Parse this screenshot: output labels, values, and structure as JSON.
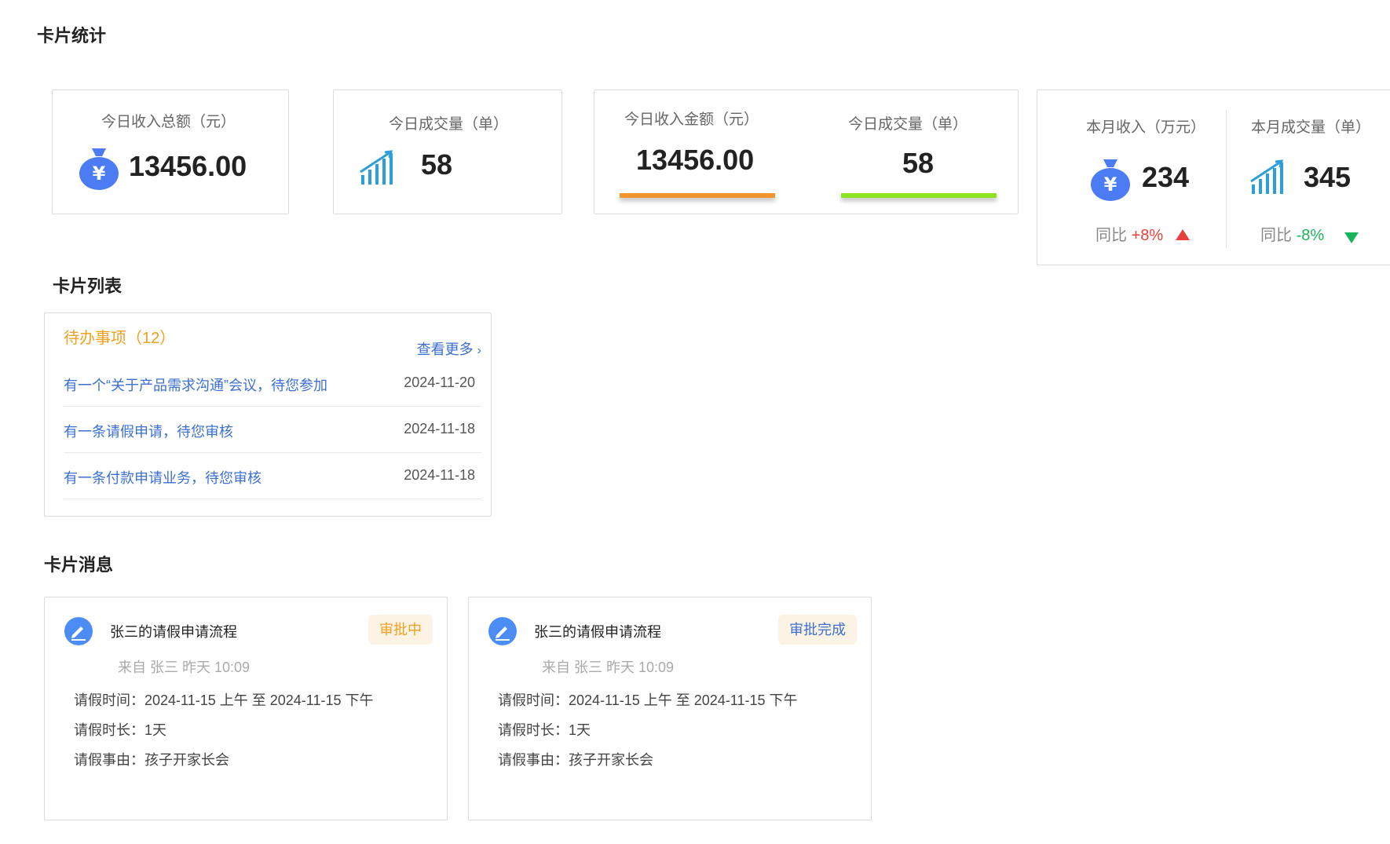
{
  "sections": {
    "stats_title": "卡片统计",
    "list_title": "卡片列表",
    "message_title": "卡片消息"
  },
  "stats": {
    "card1": {
      "label": "今日收入总额（元）",
      "value": "13456.00",
      "icon": "money-bag-icon"
    },
    "card2": {
      "label": "今日成交量（单）",
      "value": "58",
      "icon": "bar-chart-icon"
    },
    "card3": {
      "left": {
        "label": "今日收入金额（元）",
        "value": "13456.00",
        "bar_color": "#f0962c"
      },
      "right": {
        "label": "今日成交量（单）",
        "value": "58",
        "bar_color": "#8ee31f"
      }
    },
    "card4": {
      "left": {
        "label": "本月收入（万元）",
        "value": "234",
        "trend_label": "同比",
        "trend_value": "+8%",
        "trend_color": "#e8413c",
        "trend_dir": "up"
      },
      "right": {
        "label": "本月成交量（单）",
        "value": "345",
        "trend_label": "同比",
        "trend_value": "-8%",
        "trend_color": "#19b35a",
        "trend_dir": "down"
      }
    }
  },
  "todo": {
    "header": "待办事项（12）",
    "more": "查看更多",
    "items": [
      {
        "text": "有一个“关于产品需求沟通”会议，待您参加",
        "date": "2024-11-20"
      },
      {
        "text": "有一条请假申请，待您审核",
        "date": "2024-11-18"
      },
      {
        "text": "有一条付款申请业务，待您审核",
        "date": "2024-11-18"
      }
    ]
  },
  "messages": [
    {
      "title": "张三的请假申请流程",
      "badge": "审批中",
      "badge_color": "#f0a020",
      "badge_bg": "#fdf3e4",
      "from": "来自 张三 昨天 10:09",
      "time": "请假时间：2024-11-15 上午  至 2024-11-15 下午",
      "duration": "请假时长：1天",
      "reason": "请假事由：孩子开家长会"
    },
    {
      "title": "张三的请假申请流程",
      "badge": "审批完成",
      "badge_color": "#3b6fd1",
      "badge_bg": "#fdf3e4",
      "from": "来自 张三 昨天 10:09",
      "time": "请假时间：2024-11-15 上午  至 2024-11-15 下午",
      "duration": "请假时长：1天",
      "reason": "请假事由：孩子开家长会"
    }
  ]
}
